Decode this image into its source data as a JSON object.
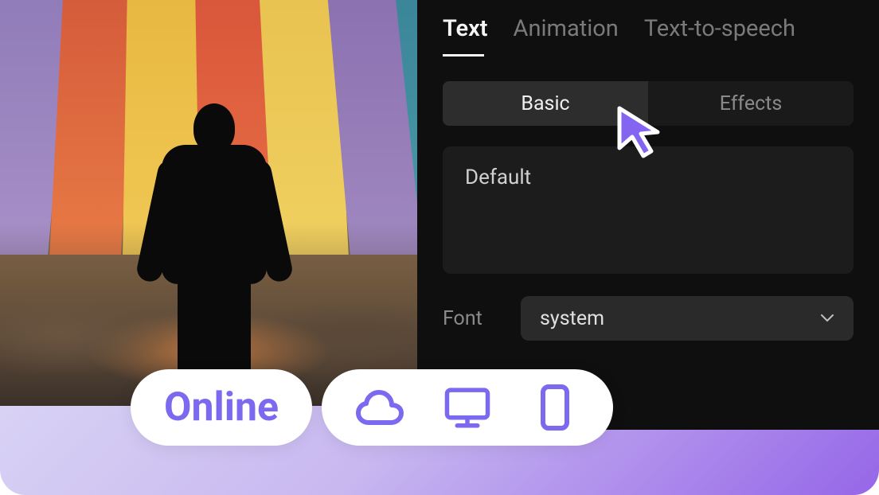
{
  "panel": {
    "tabs_primary": [
      "Text",
      "Animation",
      "Text-to-speech"
    ],
    "tabs_primary_active": 0,
    "tabs_secondary": [
      "Basic",
      "Effects"
    ],
    "tabs_secondary_active": 0,
    "preset_label": "Default",
    "font_label": "Font",
    "font_value": "system"
  },
  "bottom": {
    "label": "Online",
    "icons": [
      "cloud",
      "monitor",
      "phone"
    ]
  },
  "colors": {
    "accent": "#7b6af0",
    "panel_bg": "#0f0f0f"
  }
}
